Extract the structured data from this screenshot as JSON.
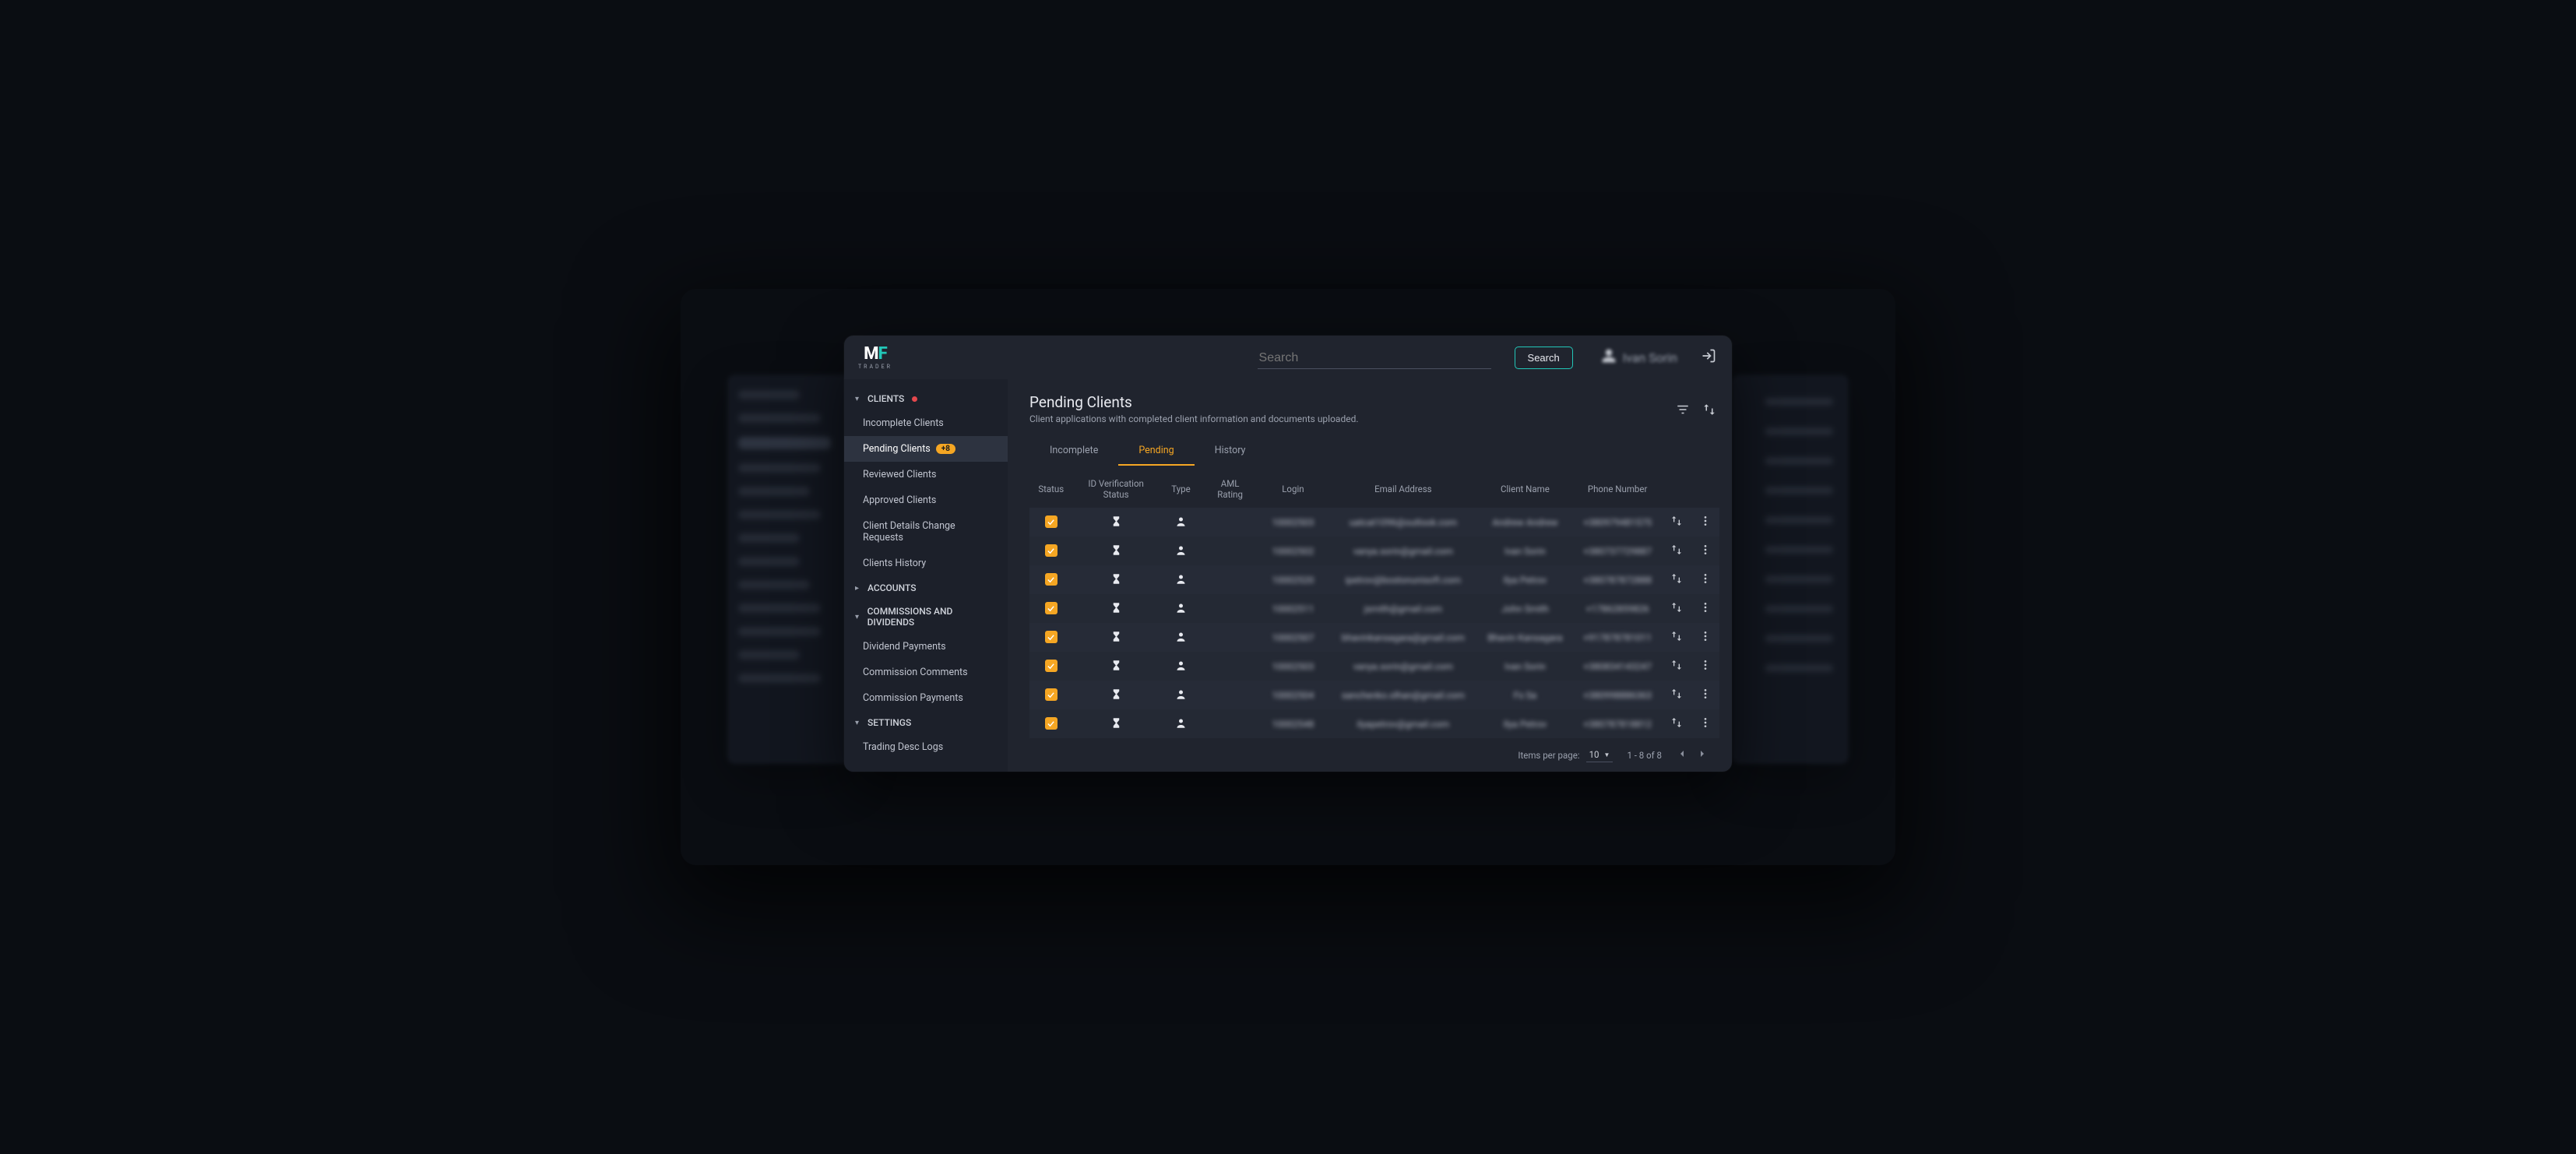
{
  "brand": {
    "mark_left": "M",
    "mark_right": "F",
    "sub": "TRADER"
  },
  "header": {
    "search_placeholder": "Search",
    "search_button": "Search",
    "user_name": "Ivan Sorin"
  },
  "sidebar": {
    "sections": [
      {
        "label": "CLIENTS",
        "expanded": true,
        "has_dot": true,
        "items": [
          {
            "label": "Incomplete Clients",
            "active": false
          },
          {
            "label": "Pending Clients",
            "active": true,
            "badge": "+8"
          },
          {
            "label": "Reviewed Clients",
            "active": false
          },
          {
            "label": "Approved Clients",
            "active": false
          },
          {
            "label": "Client Details Change Requests",
            "active": false
          },
          {
            "label": "Clients History",
            "active": false
          }
        ]
      },
      {
        "label": "ACCOUNTS",
        "expanded": false,
        "items": []
      },
      {
        "label": "COMMISSIONS AND DIVIDENDS",
        "expanded": true,
        "items": [
          {
            "label": "Dividend Payments"
          },
          {
            "label": "Commission Comments"
          },
          {
            "label": "Commission Payments"
          }
        ]
      },
      {
        "label": "SETTINGS",
        "expanded": true,
        "items": [
          {
            "label": "Trading Desc Logs"
          }
        ]
      }
    ]
  },
  "page": {
    "title": "Pending Clients",
    "subtitle": "Client applications with completed client information and documents uploaded."
  },
  "tabs": [
    {
      "label": "Incomplete",
      "active": false
    },
    {
      "label": "Pending",
      "active": true
    },
    {
      "label": "History",
      "active": false
    }
  ],
  "table": {
    "columns": [
      "Status",
      "ID Verification Status",
      "Type",
      "AML Rating",
      "Login",
      "Email Address",
      "Client Name",
      "Phone Number"
    ],
    "rows": [
      {
        "login": "10002503",
        "email": "uatcat1096@outlook.com",
        "name": "Andrew Andrew",
        "phone": "+380979481575"
      },
      {
        "login": "10002502",
        "email": "vanya.sorin@gmail.com",
        "name": "Ivan Sorin",
        "phone": "+380737729887"
      },
      {
        "login": "10002520",
        "email": "ipetrov@bostonunisoft.com",
        "name": "Ilya Petrov",
        "phone": "+380787872888"
      },
      {
        "login": "10002511",
        "email": "jsmith@gmail.com",
        "name": "John Smith",
        "phone": "+17862859826"
      },
      {
        "login": "10002507",
        "email": "bhavinkansagara@gmail.com",
        "name": "Bhavin Kansagara",
        "phone": "+917878781011"
      },
      {
        "login": "10002503",
        "email": "vanya.sorin@gmail.com",
        "name": "Ivan Sorin",
        "phone": "+380834143247"
      },
      {
        "login": "10002504",
        "email": "sanchenko.olhan@gmail.com",
        "name": "Fs Sa",
        "phone": "+380998886363"
      },
      {
        "login": "10002548",
        "email": "ilyapetrov@gmail.com",
        "name": "Ilya Petrov",
        "phone": "+380787818812"
      }
    ]
  },
  "pagination": {
    "items_per_page_label": "Items per page:",
    "items_per_page_value": "10",
    "range_label": "1 - 8 of 8"
  },
  "colors": {
    "accent_teal": "#22c7b8",
    "accent_orange": "#f5a623",
    "bg_app": "#20242e",
    "bg_sidebar": "#1c202a"
  }
}
